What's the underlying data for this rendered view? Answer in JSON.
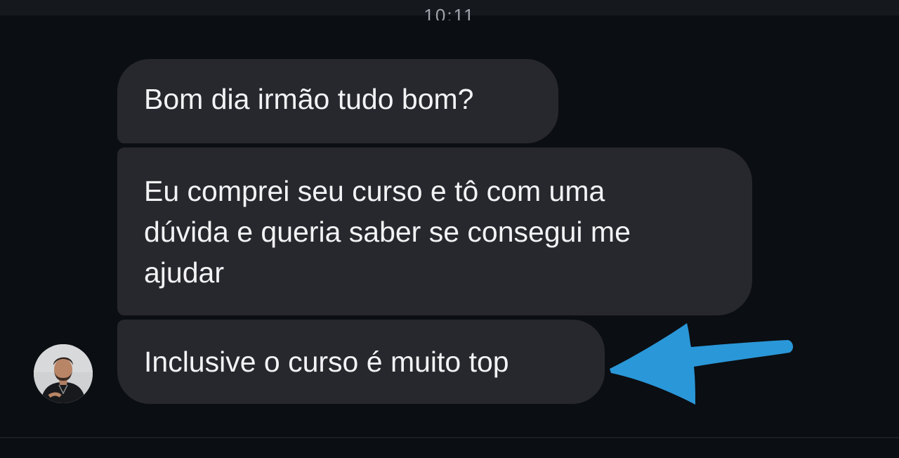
{
  "status": {
    "time": "10:11"
  },
  "conversation": {
    "messages": [
      {
        "lines": [
          "Bom dia irmão tudo bom?"
        ]
      },
      {
        "lines": [
          "Eu comprei seu curso e tô com uma",
          "dúvida e queria saber se consegui me",
          "ajudar"
        ]
      },
      {
        "lines": [
          "Inclusive o curso é muito top"
        ]
      }
    ],
    "sender_avatar_icon": "profile-photo-avatar"
  },
  "annotation": {
    "icon": "arrow-left-icon",
    "color": "#2a97d8"
  },
  "colors": {
    "background": "#0b0e13",
    "bubble": "#26282d",
    "text": "#f3f3f5"
  }
}
